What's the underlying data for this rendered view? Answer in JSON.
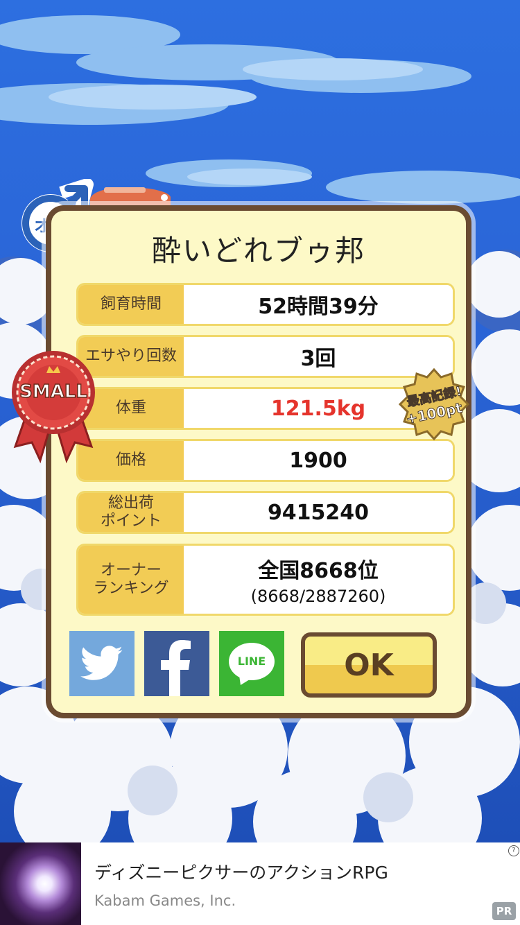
{
  "dialog": {
    "name": "酔いどれブゥ邦",
    "rows": [
      {
        "label_lines": [
          "飼育時間"
        ],
        "value": "52時間39分",
        "sub": ""
      },
      {
        "label_lines": [
          "エサやり回数"
        ],
        "value": "3回",
        "sub": ""
      },
      {
        "label_lines": [
          "体重"
        ],
        "value": "121.5kg",
        "sub": ""
      },
      {
        "label_lines": [
          "価格"
        ],
        "value": "1900",
        "sub": ""
      },
      {
        "label_lines": [
          "総出荷",
          "ポイント"
        ],
        "value": "9415240",
        "sub": ""
      },
      {
        "label_lines": [
          "オーナー",
          "ランキング"
        ],
        "value": "全国8668位",
        "sub": "(8668/2887260)"
      }
    ],
    "ok_label": "OK"
  },
  "gender_badge": {
    "text": "オス",
    "icon": "male-symbol-icon"
  },
  "size_ribbon": {
    "text": "SMALL",
    "icon": "award-ribbon-icon"
  },
  "record_badge": {
    "line1": "最高記録!",
    "line2": "+100pt"
  },
  "share": [
    {
      "icon": "twitter-icon",
      "color": "#74a8dc"
    },
    {
      "icon": "facebook-icon",
      "color": "#3c5a96"
    },
    {
      "icon": "line-icon",
      "label": "LINE",
      "color": "#3bb534"
    }
  ],
  "ad": {
    "title": "ディズニーピクサーのアクションRPG",
    "publisher": "Kabam Games, Inc.",
    "info_icon": "?",
    "badge": "PR"
  },
  "colors": {
    "sky": "#1f57c6",
    "card_bg": "#fdf9c7",
    "card_border": "#6a4b31",
    "label_bg": "#f2cc55",
    "highlight_red": "#e5342c"
  }
}
